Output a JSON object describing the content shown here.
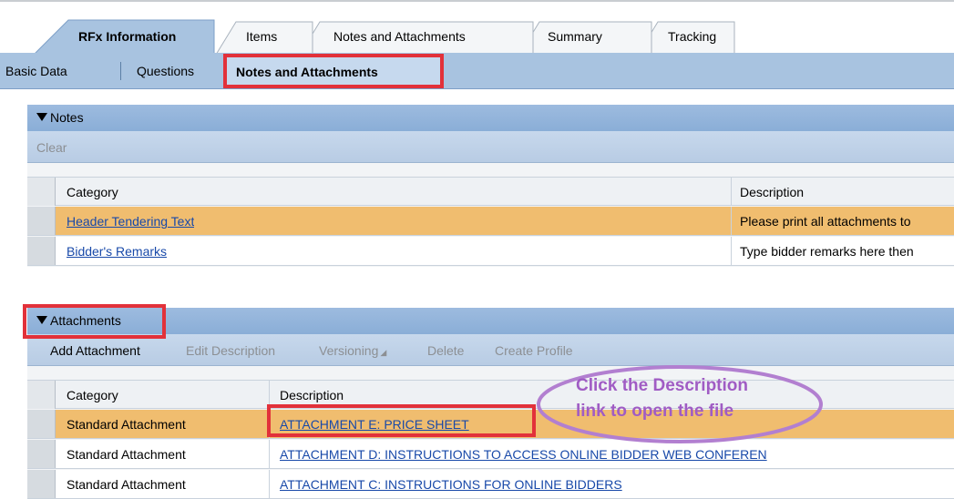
{
  "tabs": [
    {
      "label": "RFx Information",
      "active": true
    },
    {
      "label": "Items",
      "active": false
    },
    {
      "label": "Notes and Attachments",
      "active": false
    },
    {
      "label": "Summary",
      "active": false
    },
    {
      "label": "Tracking",
      "active": false
    }
  ],
  "subtabs": {
    "basic_data": "Basic Data",
    "questions": "Questions",
    "notes_attachments": "Notes and Attachments"
  },
  "notes": {
    "title": "Notes",
    "toolbar": {
      "clear": "Clear"
    },
    "columns": {
      "category": "Category",
      "description": "Description"
    },
    "rows": [
      {
        "category": "Header Tendering Text",
        "description": "Please print all attachments to"
      },
      {
        "category": "Bidder's Remarks",
        "description": "Type bidder remarks here then"
      }
    ]
  },
  "attachments": {
    "title": "Attachments",
    "toolbar": {
      "add": "Add Attachment",
      "edit": "Edit Description",
      "versioning": "Versioning",
      "delete": "Delete",
      "create_profile": "Create Profile"
    },
    "columns": {
      "category": "Category",
      "description": "Description"
    },
    "rows": [
      {
        "category": "Standard Attachment",
        "description": "ATTACHMENT E: PRICE SHEET"
      },
      {
        "category": "Standard Attachment",
        "description": "ATTACHMENT D: INSTRUCTIONS TO ACCESS ONLINE BIDDER WEB CONFEREN"
      },
      {
        "category": "Standard Attachment",
        "description": "ATTACHMENT C: INSTRUCTIONS FOR ONLINE BIDDERS"
      }
    ]
  },
  "annotation": {
    "line1": "Click the Description",
    "line2": "link to open the file"
  },
  "colors": {
    "highlight_red": "#e2313a",
    "annotation_purple": "#a05cc4",
    "selected_row": "#f0bd6f",
    "link": "#1849a9"
  }
}
